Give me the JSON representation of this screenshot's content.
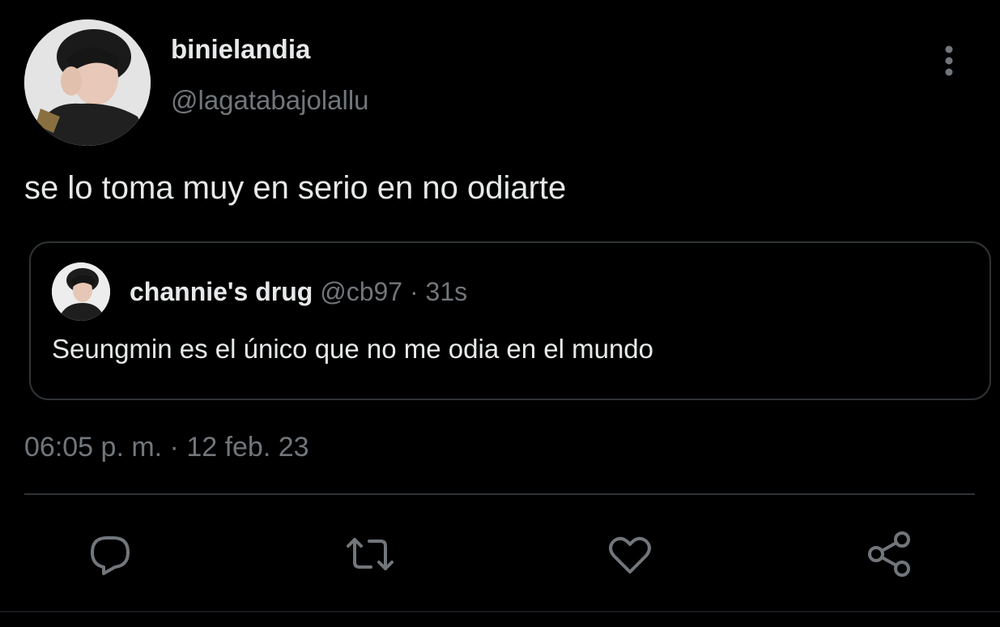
{
  "tweet": {
    "author": {
      "display_name": "binielandia",
      "handle": "@lagatabajolallu",
      "avatar": "profile-photo"
    },
    "text": "se lo toma muy en serio en no odiarte",
    "timestamp": "06:05 p. m. · 12 feb. 23"
  },
  "quote": {
    "display_name": "channie's drug",
    "meta": "@cb97 · 31s",
    "text": "Seungmin es el único que no me odia en el mundo",
    "avatar": "profile-photo"
  },
  "actions": {
    "reply_icon": "reply-icon",
    "retweet_icon": "retweet-icon",
    "like_icon": "heart-icon",
    "share_icon": "share-icon"
  },
  "more_icon": "more-vertical-icon",
  "colors": {
    "background": "#000000",
    "primary_text": "#e7e9ea",
    "secondary_text": "#71767b",
    "border": "#2f3336"
  }
}
